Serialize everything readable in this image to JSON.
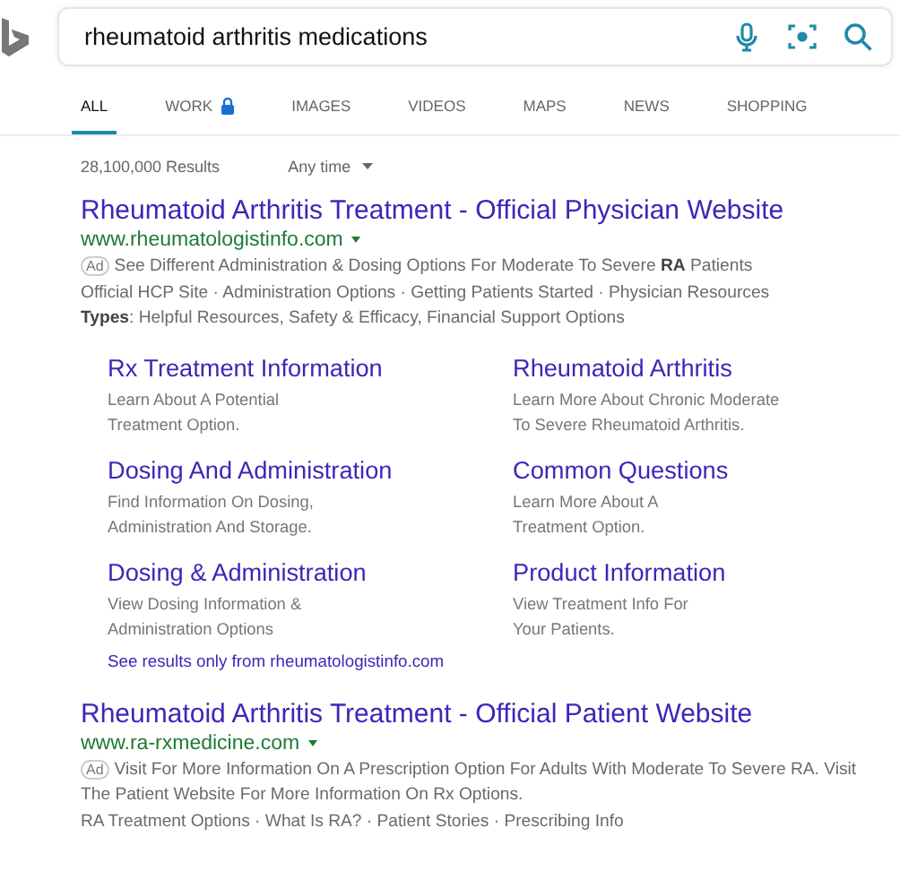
{
  "query": "rheumatoid arthritis medications",
  "tabs": [
    {
      "label": "ALL",
      "selected": true,
      "locked": false
    },
    {
      "label": "WORK",
      "selected": false,
      "locked": true
    },
    {
      "label": "IMAGES",
      "selected": false,
      "locked": false
    },
    {
      "label": "VIDEOS",
      "selected": false,
      "locked": false
    },
    {
      "label": "MAPS",
      "selected": false,
      "locked": false
    },
    {
      "label": "NEWS",
      "selected": false,
      "locked": false
    },
    {
      "label": "SHOPPING",
      "selected": false,
      "locked": false
    }
  ],
  "result_count": "28,100,000 Results",
  "time_filter": "Any time",
  "ads": [
    {
      "title": "Rheumatoid Arthritis Treatment - Official Physician Website",
      "url": "www.rheumatologistinfo.com",
      "badge": "Ad",
      "description": "See Different Administration & Dosing Options For Moderate To Severe **RA** Patients",
      "links_line": "Official HCP Site · Administration Options · Getting Patients Started · Physician Resources",
      "types": "**Types**: Helpful Resources, Safety & Efficacy, Financial Support Options",
      "sitelinks": [
        {
          "title": "Rx Treatment Information",
          "description": "Learn About A Potential\nTreatment Option."
        },
        {
          "title": "Rheumatoid Arthritis",
          "description": "Learn More About Chronic Moderate\nTo Severe Rheumatoid Arthritis."
        },
        {
          "title": "Dosing And Administration",
          "description": "Find Information On Dosing,\nAdministration And Storage."
        },
        {
          "title": "Common Questions",
          "description": "Learn More About A\nTreatment Option."
        },
        {
          "title": "Dosing & Administration",
          "description": "View Dosing Information &\nAdministration Options"
        },
        {
          "title": "Product Information",
          "description": "View Treatment Info For\nYour Patients."
        }
      ],
      "more_link": "See results only from rheumatologistinfo.com"
    },
    {
      "title": "Rheumatoid Arthritis Treatment - Official Patient Website",
      "url": "www.ra-rxmedicine.com",
      "badge": "Ad",
      "description": "Visit For More Information On A Prescription Option For Adults With Moderate To Severe RA. Visit The Patient Website For More Information On Rx Options.",
      "links_line": "RA Treatment Options · What Is RA? · Patient Stories · Prescribing Info"
    }
  ]
}
